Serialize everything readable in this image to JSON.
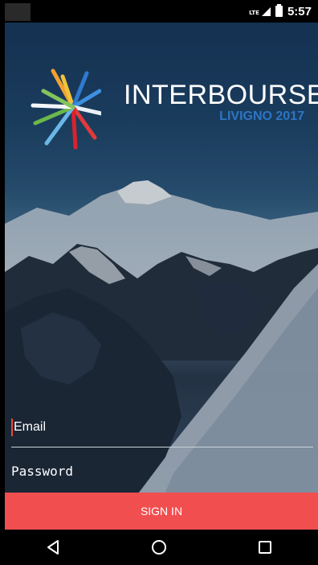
{
  "status_bar": {
    "network": "LTE",
    "time": "5:57"
  },
  "header": {
    "brand_name": "INTERBOURSE",
    "brand_sub": "LIVIGNO 2017",
    "logo_icon": "starburst-logo-icon"
  },
  "form": {
    "email_placeholder": "Email",
    "password_placeholder": "Password",
    "sign_in_label": "SIGN IN"
  },
  "colors": {
    "accent": "#f14e4f",
    "brand_blue": "#2d76c4",
    "cursor": "#e8483f"
  },
  "nav": {
    "back_icon": "back-triangle-icon",
    "home_icon": "home-circle-icon",
    "recents_icon": "recents-square-icon"
  }
}
